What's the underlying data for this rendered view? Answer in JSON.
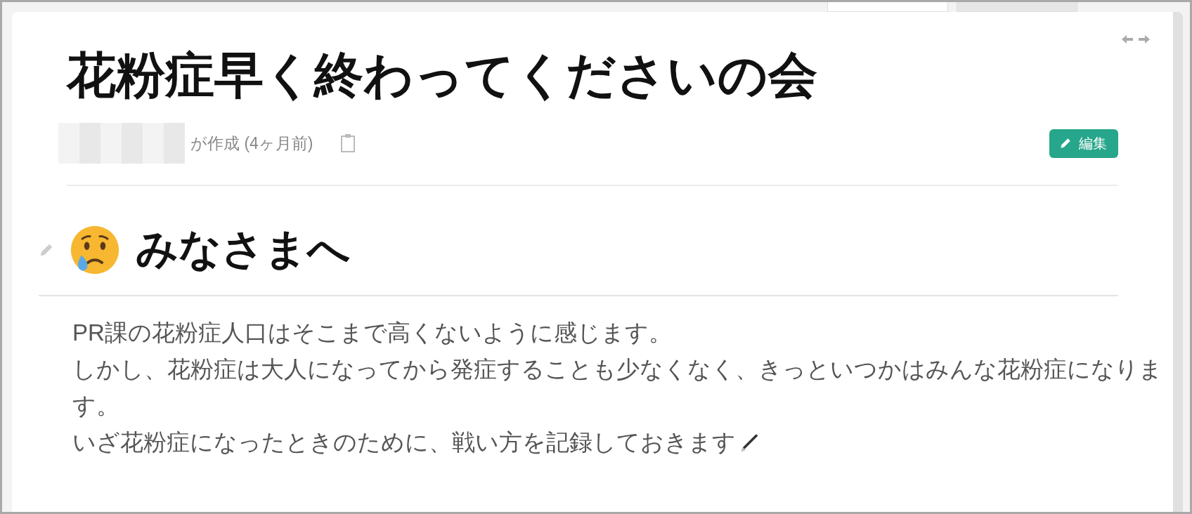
{
  "document": {
    "title": "花粉症早く終わってくださいの会",
    "meta": {
      "created": "が作成 (4ヶ月前)"
    },
    "edit_button": {
      "label": "編集"
    },
    "sections": [
      {
        "heading": "みなさまへ",
        "paragraphs": [
          "PR課の花粉症人口はそこまで高くないように感じます。",
          "しかし、花粉症は大人になってから発症することも少なくなく、きっといつかはみんな花粉症になります。",
          "いざ花粉症になったときのために、戦い方を記録しておきます"
        ]
      }
    ]
  }
}
